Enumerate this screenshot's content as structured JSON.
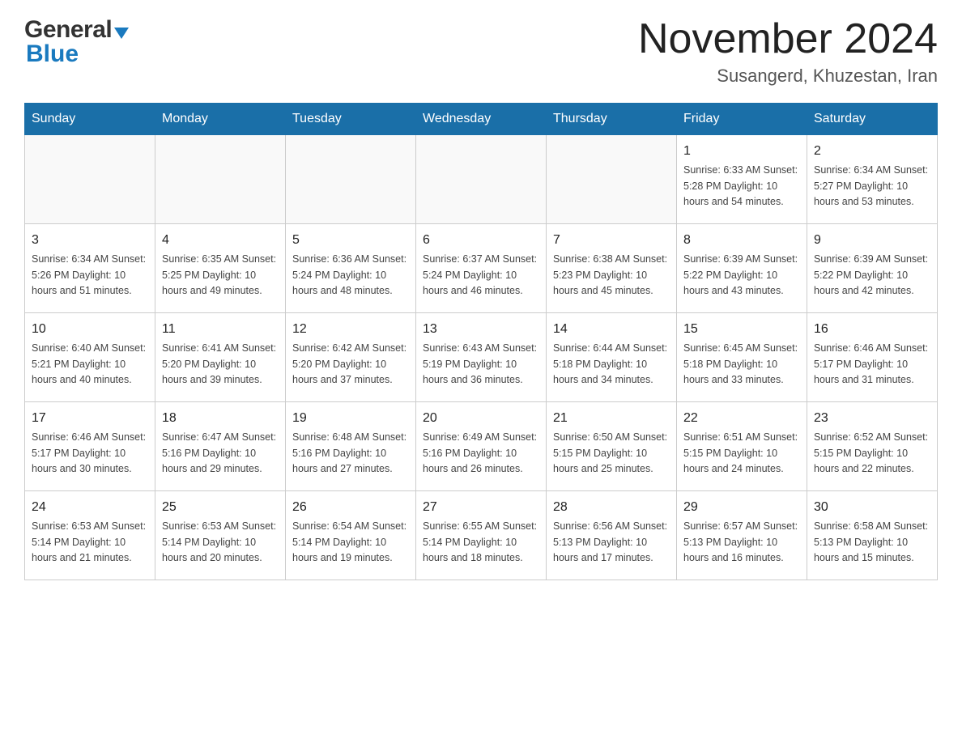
{
  "header": {
    "logo_general": "General",
    "logo_blue": "Blue",
    "month_title": "November 2024",
    "location": "Susangerd, Khuzestan, Iran"
  },
  "weekdays": [
    "Sunday",
    "Monday",
    "Tuesday",
    "Wednesday",
    "Thursday",
    "Friday",
    "Saturday"
  ],
  "weeks": [
    [
      {
        "day": "",
        "info": ""
      },
      {
        "day": "",
        "info": ""
      },
      {
        "day": "",
        "info": ""
      },
      {
        "day": "",
        "info": ""
      },
      {
        "day": "",
        "info": ""
      },
      {
        "day": "1",
        "info": "Sunrise: 6:33 AM\nSunset: 5:28 PM\nDaylight: 10 hours\nand 54 minutes."
      },
      {
        "day": "2",
        "info": "Sunrise: 6:34 AM\nSunset: 5:27 PM\nDaylight: 10 hours\nand 53 minutes."
      }
    ],
    [
      {
        "day": "3",
        "info": "Sunrise: 6:34 AM\nSunset: 5:26 PM\nDaylight: 10 hours\nand 51 minutes."
      },
      {
        "day": "4",
        "info": "Sunrise: 6:35 AM\nSunset: 5:25 PM\nDaylight: 10 hours\nand 49 minutes."
      },
      {
        "day": "5",
        "info": "Sunrise: 6:36 AM\nSunset: 5:24 PM\nDaylight: 10 hours\nand 48 minutes."
      },
      {
        "day": "6",
        "info": "Sunrise: 6:37 AM\nSunset: 5:24 PM\nDaylight: 10 hours\nand 46 minutes."
      },
      {
        "day": "7",
        "info": "Sunrise: 6:38 AM\nSunset: 5:23 PM\nDaylight: 10 hours\nand 45 minutes."
      },
      {
        "day": "8",
        "info": "Sunrise: 6:39 AM\nSunset: 5:22 PM\nDaylight: 10 hours\nand 43 minutes."
      },
      {
        "day": "9",
        "info": "Sunrise: 6:39 AM\nSunset: 5:22 PM\nDaylight: 10 hours\nand 42 minutes."
      }
    ],
    [
      {
        "day": "10",
        "info": "Sunrise: 6:40 AM\nSunset: 5:21 PM\nDaylight: 10 hours\nand 40 minutes."
      },
      {
        "day": "11",
        "info": "Sunrise: 6:41 AM\nSunset: 5:20 PM\nDaylight: 10 hours\nand 39 minutes."
      },
      {
        "day": "12",
        "info": "Sunrise: 6:42 AM\nSunset: 5:20 PM\nDaylight: 10 hours\nand 37 minutes."
      },
      {
        "day": "13",
        "info": "Sunrise: 6:43 AM\nSunset: 5:19 PM\nDaylight: 10 hours\nand 36 minutes."
      },
      {
        "day": "14",
        "info": "Sunrise: 6:44 AM\nSunset: 5:18 PM\nDaylight: 10 hours\nand 34 minutes."
      },
      {
        "day": "15",
        "info": "Sunrise: 6:45 AM\nSunset: 5:18 PM\nDaylight: 10 hours\nand 33 minutes."
      },
      {
        "day": "16",
        "info": "Sunrise: 6:46 AM\nSunset: 5:17 PM\nDaylight: 10 hours\nand 31 minutes."
      }
    ],
    [
      {
        "day": "17",
        "info": "Sunrise: 6:46 AM\nSunset: 5:17 PM\nDaylight: 10 hours\nand 30 minutes."
      },
      {
        "day": "18",
        "info": "Sunrise: 6:47 AM\nSunset: 5:16 PM\nDaylight: 10 hours\nand 29 minutes."
      },
      {
        "day": "19",
        "info": "Sunrise: 6:48 AM\nSunset: 5:16 PM\nDaylight: 10 hours\nand 27 minutes."
      },
      {
        "day": "20",
        "info": "Sunrise: 6:49 AM\nSunset: 5:16 PM\nDaylight: 10 hours\nand 26 minutes."
      },
      {
        "day": "21",
        "info": "Sunrise: 6:50 AM\nSunset: 5:15 PM\nDaylight: 10 hours\nand 25 minutes."
      },
      {
        "day": "22",
        "info": "Sunrise: 6:51 AM\nSunset: 5:15 PM\nDaylight: 10 hours\nand 24 minutes."
      },
      {
        "day": "23",
        "info": "Sunrise: 6:52 AM\nSunset: 5:15 PM\nDaylight: 10 hours\nand 22 minutes."
      }
    ],
    [
      {
        "day": "24",
        "info": "Sunrise: 6:53 AM\nSunset: 5:14 PM\nDaylight: 10 hours\nand 21 minutes."
      },
      {
        "day": "25",
        "info": "Sunrise: 6:53 AM\nSunset: 5:14 PM\nDaylight: 10 hours\nand 20 minutes."
      },
      {
        "day": "26",
        "info": "Sunrise: 6:54 AM\nSunset: 5:14 PM\nDaylight: 10 hours\nand 19 minutes."
      },
      {
        "day": "27",
        "info": "Sunrise: 6:55 AM\nSunset: 5:14 PM\nDaylight: 10 hours\nand 18 minutes."
      },
      {
        "day": "28",
        "info": "Sunrise: 6:56 AM\nSunset: 5:13 PM\nDaylight: 10 hours\nand 17 minutes."
      },
      {
        "day": "29",
        "info": "Sunrise: 6:57 AM\nSunset: 5:13 PM\nDaylight: 10 hours\nand 16 minutes."
      },
      {
        "day": "30",
        "info": "Sunrise: 6:58 AM\nSunset: 5:13 PM\nDaylight: 10 hours\nand 15 minutes."
      }
    ]
  ]
}
